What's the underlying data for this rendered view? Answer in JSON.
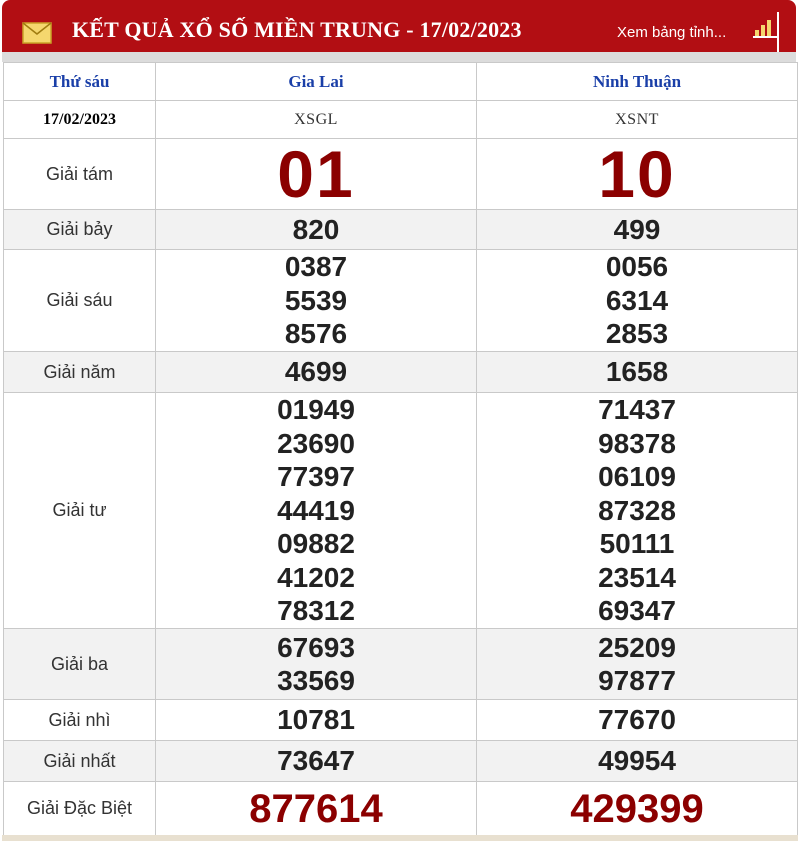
{
  "header": {
    "title": "KẾT QUẢ XỔ SỐ MIỀN TRUNG - 17/02/2023",
    "link_text": "Xem bảng tỉnh...",
    "icons": [
      "mail-icon",
      "bar-chart-icon"
    ],
    "colors": {
      "header_bg": "#b20e13",
      "prize_red": "#8b0000",
      "heading_blue": "#1a3fa8"
    }
  },
  "table": {
    "day_label": "Thứ sáu",
    "date": "17/02/2023",
    "provinces": [
      {
        "name": "Gia Lai",
        "code": "XSGL"
      },
      {
        "name": "Ninh Thuận",
        "code": "XSNT"
      }
    ],
    "prizes": {
      "g8": {
        "label": "Giải tám",
        "gl": [
          "01"
        ],
        "nt": [
          "10"
        ]
      },
      "g7": {
        "label": "Giải bảy",
        "gl": [
          "820"
        ],
        "nt": [
          "499"
        ]
      },
      "g6": {
        "label": "Giải sáu",
        "gl": [
          "0387",
          "5539",
          "8576"
        ],
        "nt": [
          "0056",
          "6314",
          "2853"
        ]
      },
      "g5": {
        "label": "Giải năm",
        "gl": [
          "4699"
        ],
        "nt": [
          "1658"
        ]
      },
      "g4": {
        "label": "Giải tư",
        "gl": [
          "01949",
          "23690",
          "77397",
          "44419",
          "09882",
          "41202",
          "78312"
        ],
        "nt": [
          "71437",
          "98378",
          "06109",
          "87328",
          "50111",
          "23514",
          "69347"
        ]
      },
      "g3": {
        "label": "Giải ba",
        "gl": [
          "67693",
          "33569"
        ],
        "nt": [
          "25209",
          "97877"
        ]
      },
      "g2": {
        "label": "Giải nhì",
        "gl": [
          "10781"
        ],
        "nt": [
          "77670"
        ]
      },
      "g1": {
        "label": "Giải nhất",
        "gl": [
          "73647"
        ],
        "nt": [
          "49954"
        ]
      },
      "db": {
        "label": "Giải Đặc Biệt",
        "gl": [
          "877614"
        ],
        "nt": [
          "429399"
        ]
      }
    }
  }
}
